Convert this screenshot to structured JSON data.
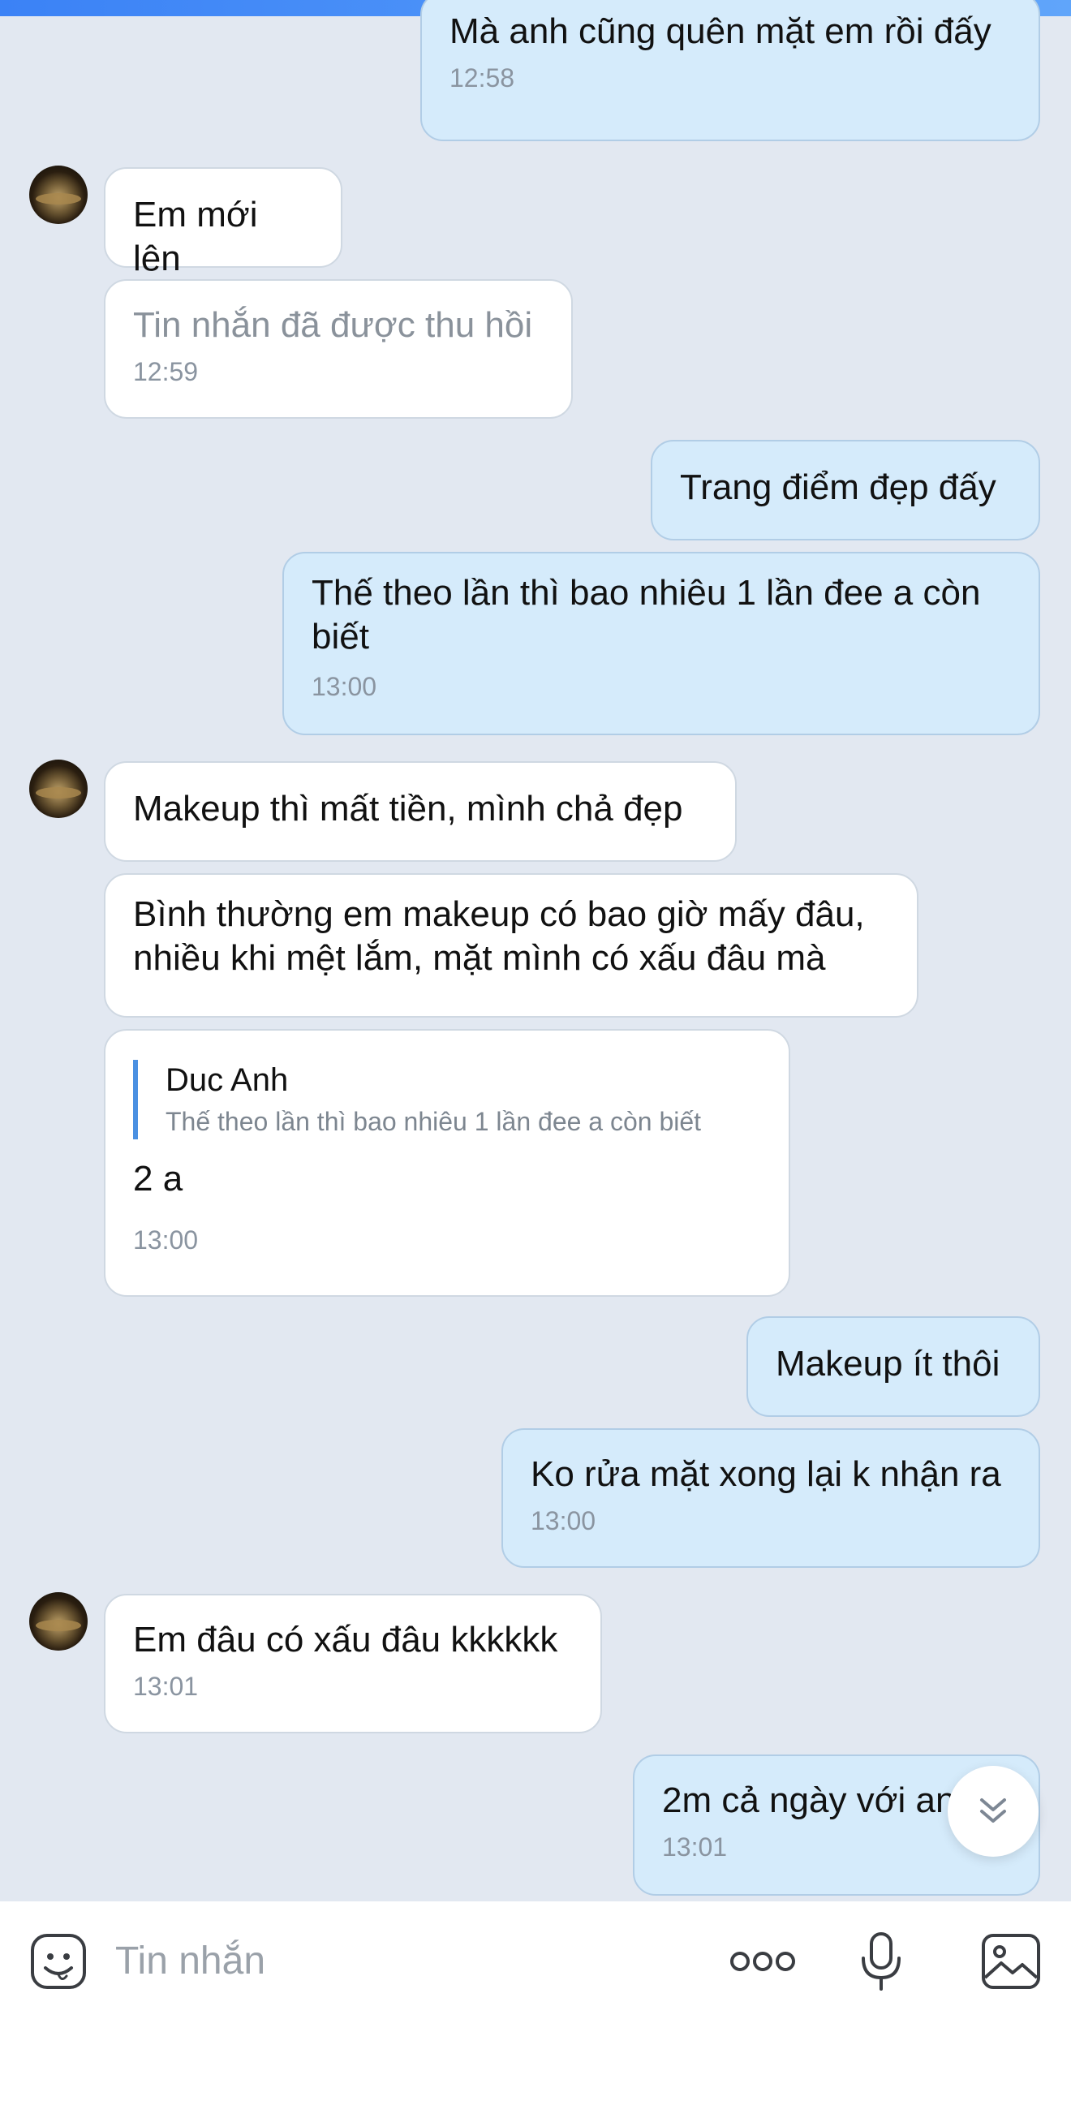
{
  "messages": [
    {
      "side": "out",
      "text": "Mà anh cũng quên mặt em rồi đấy",
      "time": "12:58"
    },
    {
      "side": "in",
      "text": "Em mới lên",
      "time": ""
    },
    {
      "side": "in",
      "text": "Tin nhắn đã được thu hồi",
      "time": "12:59",
      "recalled": true
    },
    {
      "side": "out",
      "text": "Trang điểm đẹp đấy",
      "time": ""
    },
    {
      "side": "out",
      "text": "Thế theo lần thì bao nhiêu 1 lần đee a còn biết",
      "time": "13:00"
    },
    {
      "side": "in",
      "text": "Makeup thì mất tiền, mình chả đẹp",
      "time": ""
    },
    {
      "side": "in",
      "text": "Bình thường em makeup có bao giờ mấy đâu, nhiều khi mệt lắm, mặt mình có xấu đâu mà",
      "time": ""
    },
    {
      "side": "in",
      "quote": {
        "name": "Duc Anh",
        "text": "Thế theo lần thì bao nhiêu 1 lần đee a còn biết"
      },
      "text": "2 a",
      "time": "13:00"
    },
    {
      "side": "out",
      "text": "Makeup ít thôi",
      "time": ""
    },
    {
      "side": "out",
      "text": "Ko rửa mặt xong lại k nhận ra",
      "time": "13:00"
    },
    {
      "side": "in",
      "text": "Em đâu có xấu đâu kkkkkk",
      "time": "13:01"
    },
    {
      "side": "out",
      "text": "2m cả ngày với an",
      "time": "13:01"
    }
  ],
  "composer": {
    "placeholder": "Tin nhắn",
    "icons": [
      "emoji-icon",
      "more-icon",
      "microphone-icon",
      "image-icon"
    ]
  },
  "colors": {
    "background": "#e2e8f1",
    "incoming_bubble": "#ffffff",
    "outgoing_bubble": "#d5ebfb",
    "accent": "#4a90e2"
  }
}
